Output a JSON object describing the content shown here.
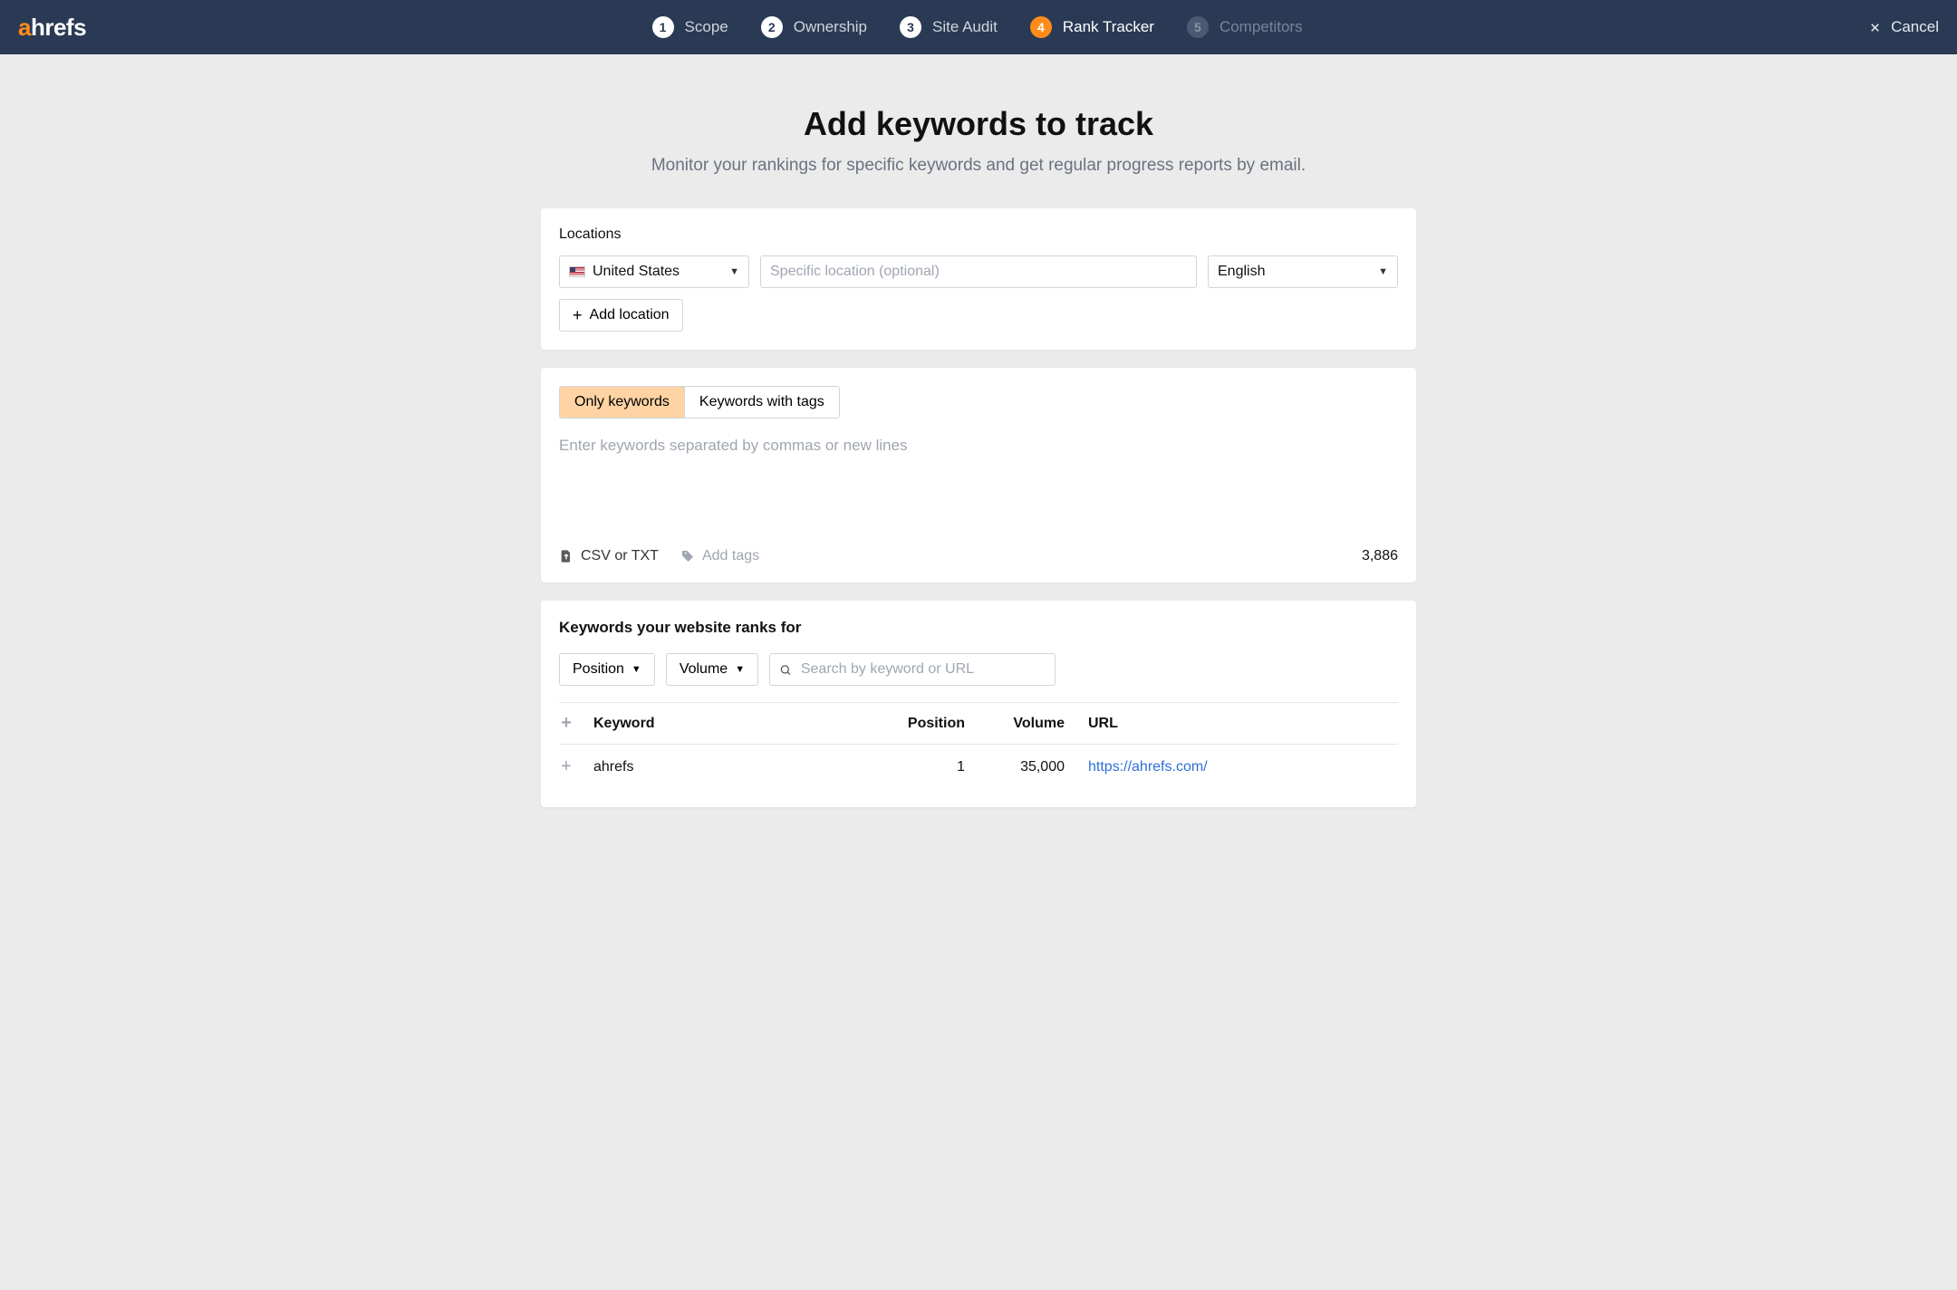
{
  "logo": {
    "text_a": "a",
    "text_rest": "hrefs"
  },
  "steps": [
    {
      "num": "1",
      "label": "Scope",
      "state": "done"
    },
    {
      "num": "2",
      "label": "Ownership",
      "state": "done"
    },
    {
      "num": "3",
      "label": "Site Audit",
      "state": "done"
    },
    {
      "num": "4",
      "label": "Rank Tracker",
      "state": "active"
    },
    {
      "num": "5",
      "label": "Competitors",
      "state": "disabled"
    }
  ],
  "cancel_label": "Cancel",
  "page_title": "Add keywords to track",
  "page_subtitle": "Monitor your rankings for specific keywords and get regular progress reports by email.",
  "locations": {
    "label": "Locations",
    "country_selected": "United States",
    "specific_placeholder": "Specific location (optional)",
    "language_selected": "English",
    "add_location_label": "Add location"
  },
  "keywords": {
    "tabs": [
      {
        "label": "Only keywords",
        "active": true
      },
      {
        "label": "Keywords with tags",
        "active": false
      }
    ],
    "textarea_placeholder": "Enter keywords separated by commas or new lines",
    "upload_label": "CSV or TXT",
    "add_tags_label": "Add tags",
    "remaining_count": "3,886"
  },
  "ranks": {
    "section_title": "Keywords your website ranks for",
    "filters": {
      "position_label": "Position",
      "volume_label": "Volume",
      "search_placeholder": "Search by keyword or URL"
    },
    "columns": {
      "keyword": "Keyword",
      "position": "Position",
      "volume": "Volume",
      "url": "URL"
    },
    "rows": [
      {
        "keyword": "ahrefs",
        "position": "1",
        "volume": "35,000",
        "url": "https://ahrefs.com/"
      }
    ]
  }
}
